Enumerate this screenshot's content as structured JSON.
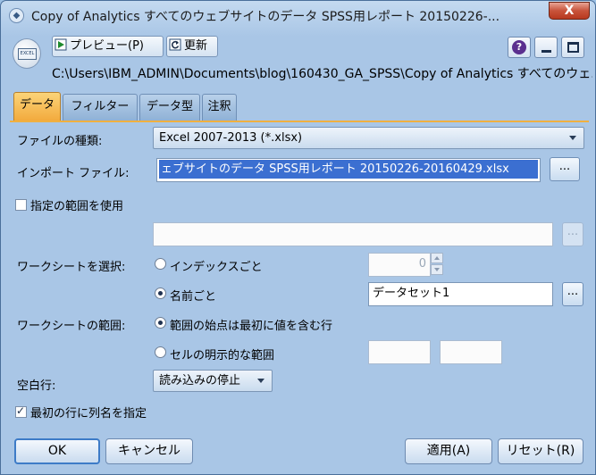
{
  "window": {
    "title": "Copy of Analytics すべてのウェブサイトのデータ SPSS用レポート 20150226-...",
    "close_label": "X"
  },
  "toolbar": {
    "preview_label": "プレビュー(P)",
    "refresh_label": "更新",
    "node_icon_text": "EXCEL",
    "help_label": "?"
  },
  "path": "C:\\Users\\IBM_ADMIN\\Documents\\blog\\160430_GA_SPSS\\Copy of Analytics すべてのウェ...",
  "tabs": [
    {
      "label": "データ",
      "active": true
    },
    {
      "label": "フィルター",
      "active": false
    },
    {
      "label": "データ型",
      "active": false
    },
    {
      "label": "注釈",
      "active": false
    }
  ],
  "form": {
    "file_type_label": "ファイルの種類:",
    "file_type_value": "Excel 2007-2013 (*.xlsx)",
    "import_file_label": "インポート ファイル:",
    "import_file_value": "ェブサイトのデータ SPSS用レポート 20150226-20160429.xlsx",
    "browse_label": "...",
    "use_range_label": "指定の範囲を使用",
    "use_range_checked": false,
    "range_value": "",
    "worksheet_select_label": "ワークシートを選択:",
    "by_index_label": "インデックスごと",
    "index_value": "0",
    "by_name_label": "名前ごと",
    "sheet_name_value": "データセット1",
    "worksheet_range_label": "ワークシートの範囲:",
    "range_first_value_label": "範囲の始点は最初に値を含む行",
    "explicit_range_label": "セルの明示的な範囲",
    "explicit_start": "",
    "explicit_end": "",
    "blank_rows_label": "空白行:",
    "blank_rows_value": "読み込みの停止",
    "first_row_names_label": "最初の行に列名を指定",
    "first_row_names_checked": true
  },
  "buttons": {
    "ok": "OK",
    "cancel": "キャンセル",
    "apply": "適用(A)",
    "reset": "リセット(R)"
  }
}
